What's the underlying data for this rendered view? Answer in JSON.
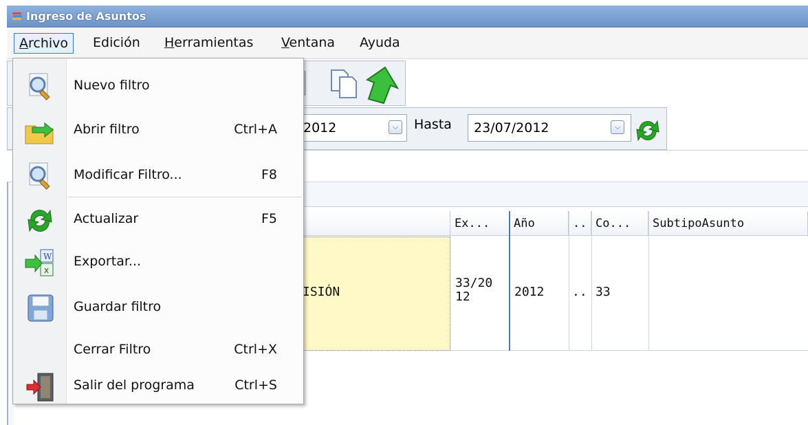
{
  "window": {
    "title": "Ingreso de Asuntos"
  },
  "menubar": {
    "items": [
      {
        "label": "Archivo",
        "mnemonic": "A",
        "rest": "rchivo"
      },
      {
        "label": "Edición"
      },
      {
        "label": "Herramientas",
        "mnemonic": "H",
        "rest": "erramientas"
      },
      {
        "label": "Ventana",
        "mnemonic": "V",
        "rest": "entana"
      },
      {
        "label": "Ayuda"
      }
    ]
  },
  "filter": {
    "desde_value": "2012",
    "hasta_label": "Hasta",
    "hasta_value": "23/07/2012"
  },
  "grid": {
    "columns": [
      "Ex...",
      "Año",
      "..",
      "Co...",
      "SubtipoAsunto"
    ],
    "row": {
      "partial_text": "ISIÓN",
      "ex": "33/2012",
      "ex_line1": "33/20",
      "ex_line2": "12",
      "anio": "2012",
      "dots": "..",
      "co": "33"
    }
  },
  "archivo_menu": {
    "items": [
      {
        "label": "Nuevo filtro",
        "shortcut": "",
        "icon": "magnifier-page-icon"
      },
      {
        "label": "Abrir filtro",
        "shortcut": "Ctrl+A",
        "icon": "open-folder-icon"
      },
      {
        "label": "Modificar Filtro...",
        "shortcut": "F8",
        "icon": "magnifier-page-icon"
      },
      {
        "label": "Actualizar",
        "shortcut": "F5",
        "icon": "refresh-icon"
      },
      {
        "label": "Exportar...",
        "shortcut": "",
        "icon": "export-office-icon"
      },
      {
        "label": "Guardar filtro",
        "shortcut": "",
        "icon": "floppy-disk-icon"
      },
      {
        "label": "Cerrar Filtro",
        "shortcut": "Ctrl+X",
        "icon": ""
      },
      {
        "label": "Salir del programa",
        "shortcut": "Ctrl+S",
        "icon": "exit-door-icon"
      }
    ]
  },
  "colors": {
    "title_bar": "#7aa0d2",
    "menu_active_border": "#3b78c6",
    "selected_cell": "#fff9c8",
    "refresh_green": "#2aa52a"
  }
}
